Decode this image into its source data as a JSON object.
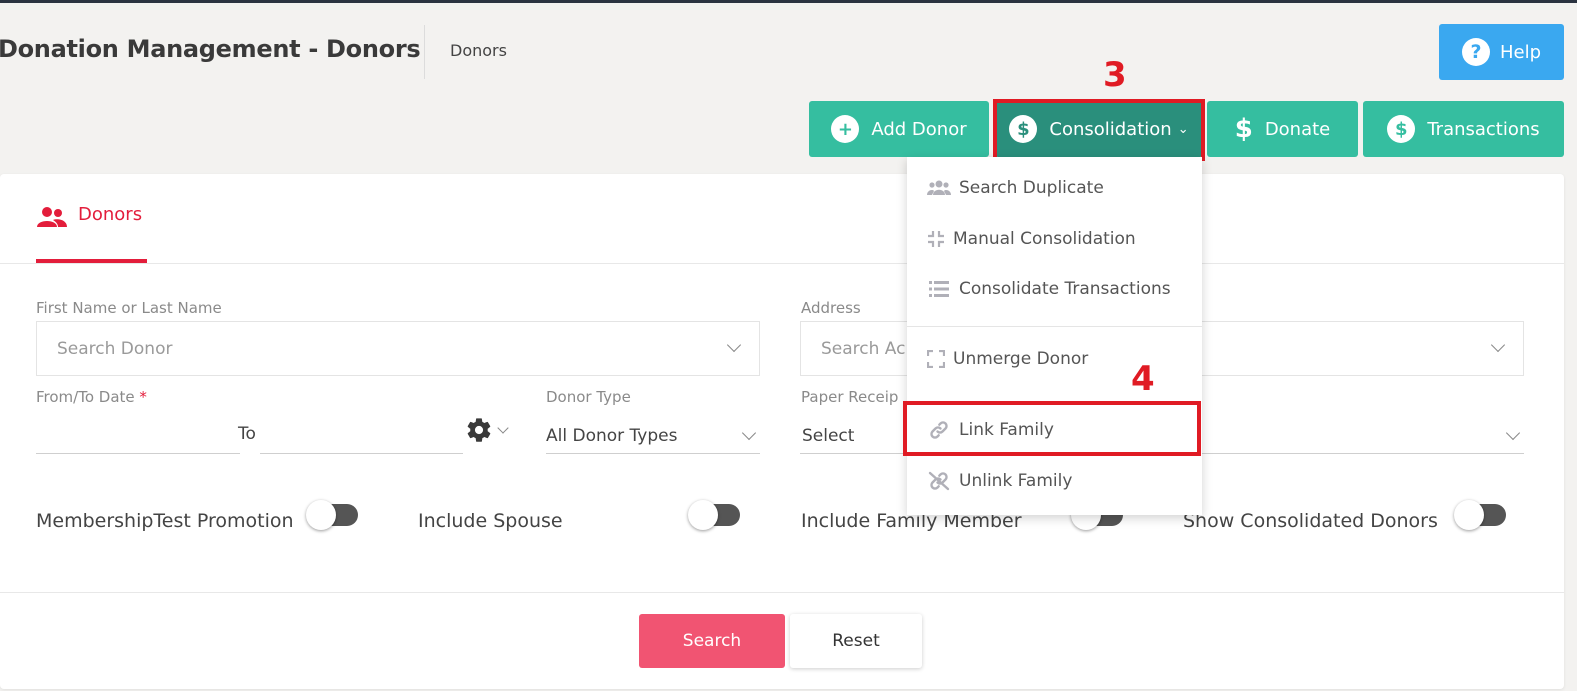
{
  "header": {
    "title": "Donation Management - Donors",
    "breadcrumb": "Donors",
    "help_label": "Help"
  },
  "toolbar": {
    "add_donor": "Add Donor",
    "consolidation": "Consolidation",
    "donate": "Donate",
    "transactions": "Transactions"
  },
  "annotations": {
    "step_3": "3",
    "step_4": "4"
  },
  "consolidation_menu": {
    "items": [
      {
        "label": "Search Duplicate",
        "icon": "users-icon"
      },
      {
        "label": "Manual Consolidation",
        "icon": "compress-icon"
      },
      {
        "label": "Consolidate Transactions",
        "icon": "list-icon"
      },
      {
        "label": "Unmerge Donor",
        "icon": "expand-icon"
      },
      {
        "label": "Link Family",
        "icon": "link-icon"
      },
      {
        "label": "Unlink Family",
        "icon": "unlink-icon"
      }
    ]
  },
  "tabs": {
    "donors": "Donors"
  },
  "form": {
    "name_label": "First Name or Last Name",
    "name_placeholder": "Search Donor",
    "address_label": "Address",
    "address_placeholder": "Search Ac",
    "date_label": "From/To Date",
    "date_required": "*",
    "date_to": "To",
    "donor_type_label": "Donor Type",
    "donor_type_value": "All Donor Types",
    "paper_receipt_label": "Paper Receip",
    "paper_receipt_value": "Select"
  },
  "toggles": {
    "membership": "MembershipTest Promotion",
    "spouse": "Include Spouse",
    "family": "Include Family Member",
    "consolidated": "Show Consolidated Donors"
  },
  "actions": {
    "search": "Search",
    "reset": "Reset"
  },
  "colors": {
    "accent_green": "#35bea0",
    "active_green": "#2a8f7c",
    "help_blue": "#3aa8f0",
    "primary_red": "#e31d3b",
    "search_pink": "#f15472",
    "annotation_red": "#e01b24"
  }
}
